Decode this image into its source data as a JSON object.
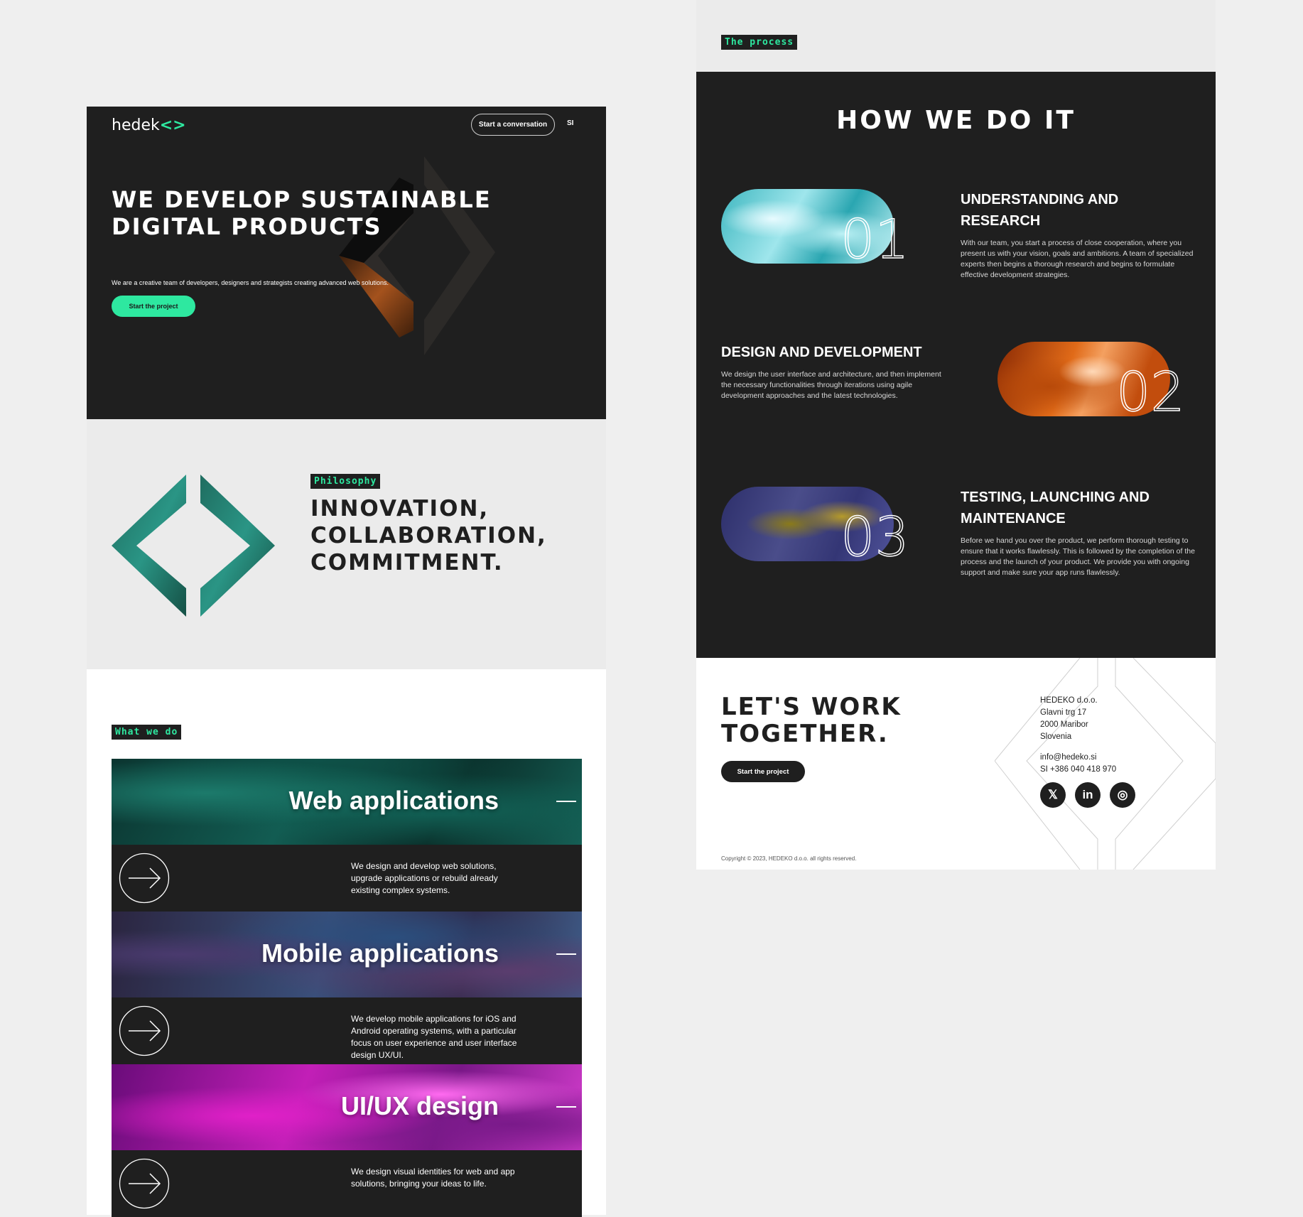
{
  "hero": {
    "logo_text": "hedek",
    "logo_accent": "<>",
    "cta_conversation": "Start a conversation",
    "language": "SI",
    "headline": "WE DEVELOP SUSTAINABLE DIGITAL PRODUCTS",
    "subtitle": "We are a creative team of developers, designers and strategists creating advanced web solutions.",
    "cta_start": "Start the project"
  },
  "philosophy": {
    "tag": "Philosophy",
    "headline": "INNOVATION, COLLABORATION, COMMITMENT."
  },
  "what_we_do": {
    "tag": "What we do",
    "services": [
      {
        "title": "Web applications",
        "description": "We design and develop web solutions, upgrade applications or rebuild already existing complex systems.",
        "icon": "arrow-right-icon"
      },
      {
        "title": "Mobile applications",
        "description": "We develop mobile applications for iOS and Android operating systems, with a particular focus on user experience and user interface design UX/UI.",
        "icon": "arrow-right-icon"
      },
      {
        "title": "UI/UX design",
        "description": "We design visual identities for web and app solutions, bringing your ideas to life.",
        "icon": "arrow-right-icon"
      }
    ]
  },
  "process": {
    "tag": "The process",
    "headline": "HOW WE DO IT",
    "steps": [
      {
        "number": "01",
        "title": "Understanding and research",
        "description": "With our team, you start a process of close cooperation, where you present us with your vision, goals and ambitions. A team of specialized experts then begins a thorough research and begins to formulate effective development strategies."
      },
      {
        "number": "02",
        "title": "Design and development",
        "description": "We design the user interface and architecture, and then implement the necessary functionalities through iterations using agile development approaches and the latest technologies."
      },
      {
        "number": "03",
        "title": "Testing, launching and maintenance",
        "description": "Before we hand you over the product, we perform thorough testing to ensure that it works flawlessly. This is followed by the completion of the process and the launch of your product. We provide you with ongoing support and make sure your app runs flawlessly."
      }
    ]
  },
  "contact": {
    "headline": "LET'S WORK TOGETHER.",
    "cta_start": "Start the project",
    "company": "HEDEKO d.o.o.",
    "street": "Glavni trg 17",
    "city": "2000 Maribor",
    "country": "Slovenia",
    "email": "info@hedeko.si",
    "phone": "SI +386 040 418 970",
    "social": {
      "x": "𝕏",
      "linkedin": "in",
      "instagram": "◎"
    },
    "copyright": "Copyright © 2023, HEDEKO d.o.o. all rights reserved."
  },
  "colors": {
    "accent": "#2ee8a0",
    "dark": "#1f1f1f",
    "light": "#ebebeb"
  }
}
